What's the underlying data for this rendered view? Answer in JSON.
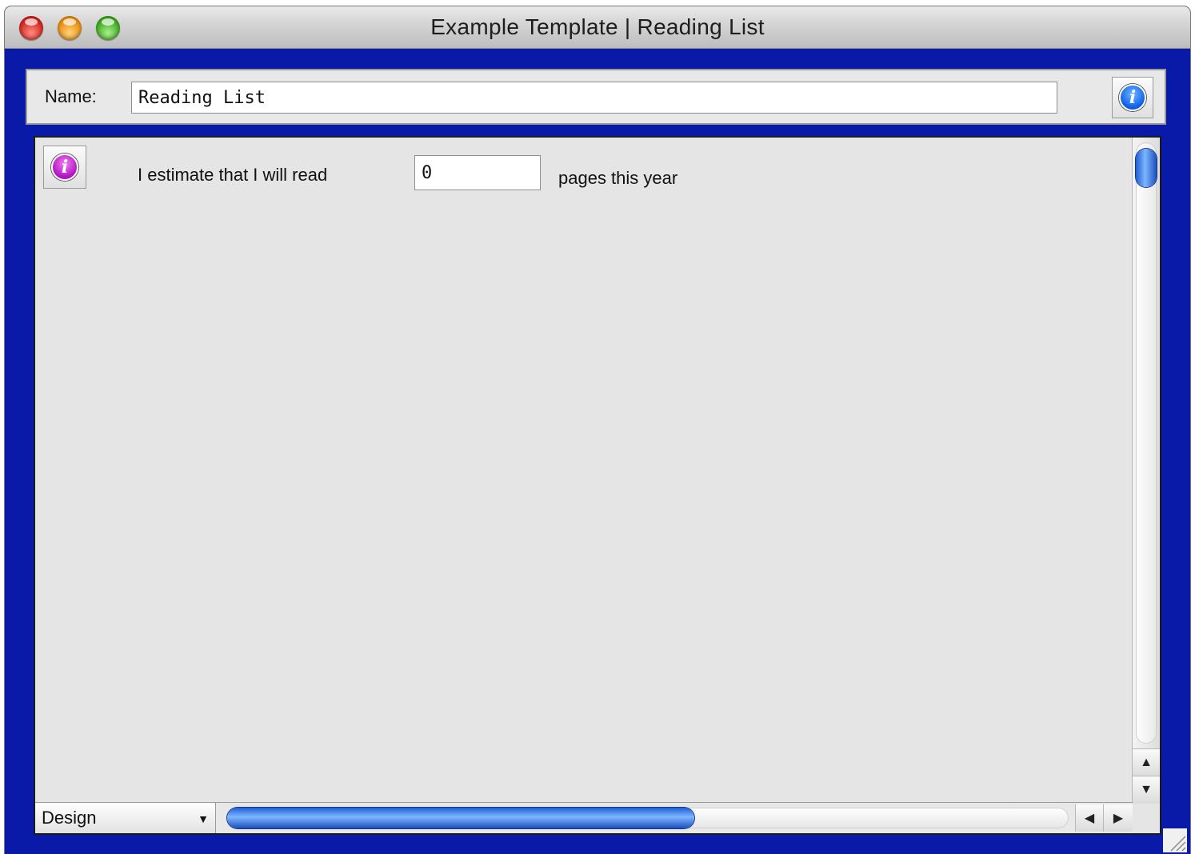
{
  "window": {
    "title": "Example Template | Reading List"
  },
  "header": {
    "name_label": "Name:",
    "name_value": "Reading List"
  },
  "record": {
    "estimate_prefix": "I estimate that I will read",
    "pages_value": "0",
    "estimate_suffix": "pages this year"
  },
  "footer": {
    "mode_selected": "Design"
  },
  "colors": {
    "window_background": "#0a1aa8",
    "info_blue": "#0a5ee8",
    "info_magenta": "#b012c0",
    "scroll_thumb": "#1e5ed6"
  },
  "icons": {
    "header_info": "info-icon",
    "record_info": "info-icon"
  }
}
